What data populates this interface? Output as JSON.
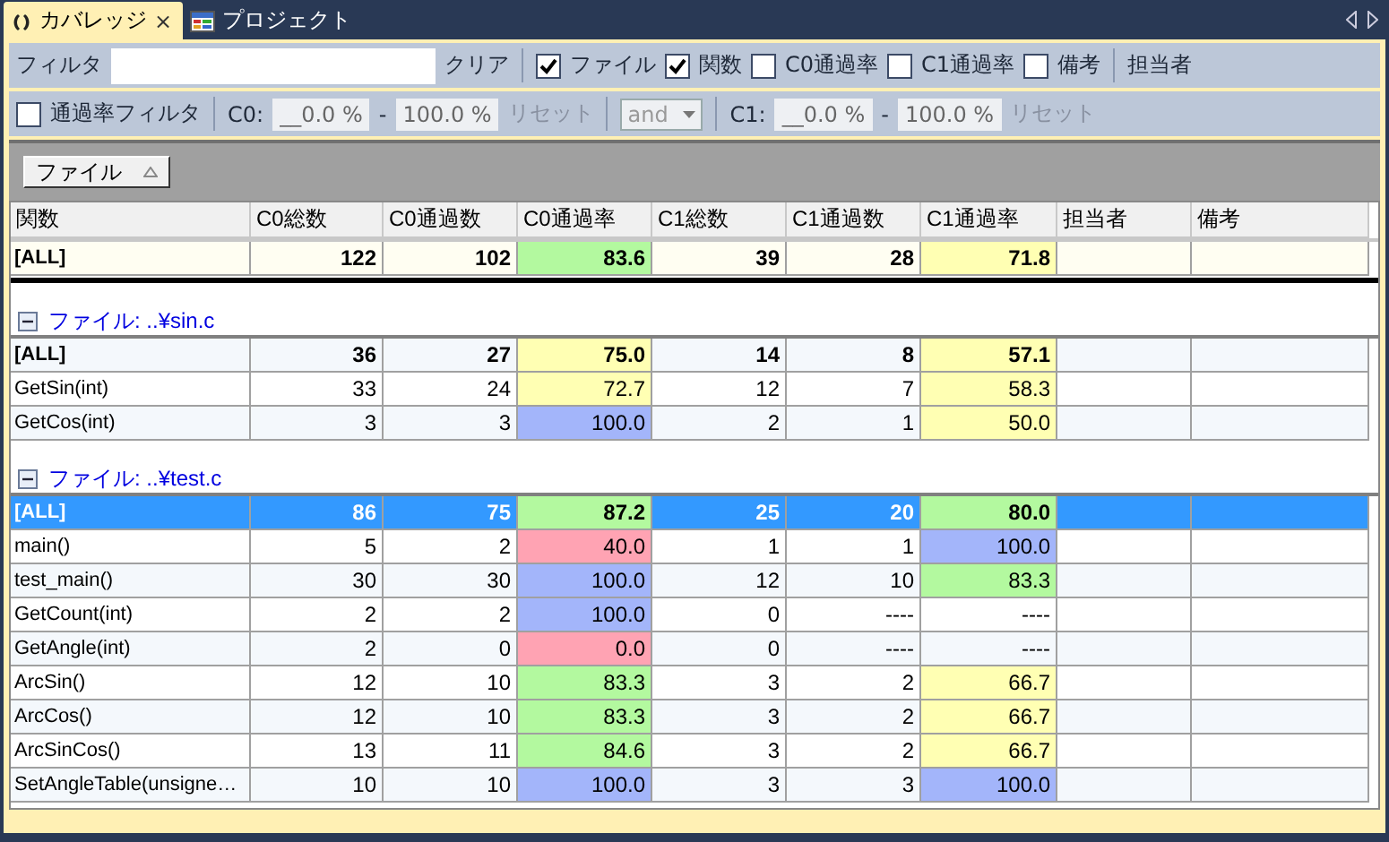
{
  "tabs": [
    {
      "label": "カバレッジ",
      "selected": true,
      "close": "×"
    },
    {
      "label": "プロジェクト",
      "selected": false
    }
  ],
  "toolbar": {
    "filter_label": "フィルタ",
    "clear_button": "クリア",
    "toggles": [
      {
        "label": "ファイル",
        "checked": true
      },
      {
        "label": "関数",
        "checked": true
      },
      {
        "label": "C0通過率",
        "checked": false
      },
      {
        "label": "C1通過率",
        "checked": false
      },
      {
        "label": "備考",
        "checked": false
      }
    ],
    "owner_button": "担当者"
  },
  "rate_filter": {
    "toggle": {
      "label": "通過率フィルタ",
      "checked": false
    },
    "ranges": [
      {
        "label": "C0:",
        "min": "__0.0 %",
        "dash": "-",
        "max": "100.0 %",
        "reset": "リセット",
        "disabled": true
      },
      {
        "label": "C1:",
        "min": "__0.0 %",
        "dash": "-",
        "max": "100.0 %",
        "reset": "リセット",
        "disabled": true
      }
    ],
    "operator": {
      "value": "and",
      "disabled": true
    }
  },
  "group_by": {
    "label": "ファイル"
  },
  "table": {
    "columns": [
      "関数",
      "C0総数",
      "C0通過数",
      "C0通過率",
      "C1総数",
      "C1通過数",
      "C1通過率",
      "担当者",
      "備考"
    ],
    "grand_total": {
      "kind": "total",
      "selected": false,
      "cells": [
        "[ALL]",
        "122",
        "102",
        {
          "text": "83.6",
          "color": "#b3f99f"
        },
        "39",
        "28",
        {
          "text": "71.8",
          "color": "#ffffb3"
        }
      ]
    },
    "groups": [
      {
        "label": "ファイル: ..¥sin.c",
        "expanded": true,
        "rows": [
          {
            "kind": "total",
            "selected": false,
            "cells": [
              "[ALL]",
              "36",
              "27",
              {
                "text": "75.0",
                "color": "#ffffb3"
              },
              "14",
              "8",
              {
                "text": "57.1",
                "color": "#ffffb3"
              }
            ]
          },
          {
            "kind": "function",
            "selected": false,
            "cells": [
              "GetSin(int)",
              "33",
              "24",
              {
                "text": "72.7",
                "color": "#ffffb3"
              },
              "12",
              "7",
              {
                "text": "58.3",
                "color": "#ffffb3"
              }
            ]
          },
          {
            "kind": "function",
            "selected": false,
            "cells": [
              "GetCos(int)",
              "3",
              "3",
              {
                "text": "100.0",
                "color": "#a3b5fa"
              },
              "2",
              "1",
              {
                "text": "50.0",
                "color": "#ffffb3"
              }
            ]
          }
        ]
      },
      {
        "label": "ファイル: ..¥test.c",
        "expanded": true,
        "rows": [
          {
            "kind": "total",
            "selected": true,
            "cells": [
              "[ALL]",
              "86",
              "75",
              {
                "text": "87.2",
                "color": "#b3f99f"
              },
              "25",
              "20",
              {
                "text": "80.0",
                "color": "#b3f99f"
              }
            ]
          },
          {
            "kind": "function",
            "selected": false,
            "cells": [
              "main()",
              "5",
              "2",
              {
                "text": "40.0",
                "color": "#ffa3b3"
              },
              "1",
              "1",
              {
                "text": "100.0",
                "color": "#a3b5fa"
              }
            ]
          },
          {
            "kind": "function",
            "selected": false,
            "cells": [
              "test_main()",
              "30",
              "30",
              {
                "text": "100.0",
                "color": "#a3b5fa"
              },
              "12",
              "10",
              {
                "text": "83.3",
                "color": "#b3f99f"
              }
            ]
          },
          {
            "kind": "function",
            "selected": false,
            "cells": [
              "GetCount(int)",
              "2",
              "2",
              {
                "text": "100.0",
                "color": "#a3b5fa"
              },
              "0",
              "----",
              "----"
            ]
          },
          {
            "kind": "function",
            "selected": false,
            "cells": [
              "GetAngle(int)",
              "2",
              "0",
              {
                "text": "0.0",
                "color": "#ffa3b3"
              },
              "0",
              "----",
              "----"
            ]
          },
          {
            "kind": "function",
            "selected": false,
            "cells": [
              "ArcSin()",
              "12",
              "10",
              {
                "text": "83.3",
                "color": "#b3f99f"
              },
              "3",
              "2",
              {
                "text": "66.7",
                "color": "#ffffb3"
              }
            ]
          },
          {
            "kind": "function",
            "selected": false,
            "cells": [
              "ArcCos()",
              "12",
              "10",
              {
                "text": "83.3",
                "color": "#b3f99f"
              },
              "3",
              "2",
              {
                "text": "66.7",
                "color": "#ffffb3"
              }
            ]
          },
          {
            "kind": "function",
            "selected": false,
            "cells": [
              "ArcSinCos()",
              "13",
              "11",
              {
                "text": "84.6",
                "color": "#b3f99f"
              },
              "3",
              "2",
              {
                "text": "66.7",
                "color": "#ffffb3"
              }
            ]
          },
          {
            "kind": "function",
            "selected": false,
            "cells": [
              "SetAngleTable(unsigne…",
              "10",
              "10",
              {
                "text": "100.0",
                "color": "#a3b5fa"
              },
              "3",
              "3",
              {
                "text": "100.0",
                "color": "#a3b5fa"
              }
            ]
          }
        ]
      }
    ]
  }
}
